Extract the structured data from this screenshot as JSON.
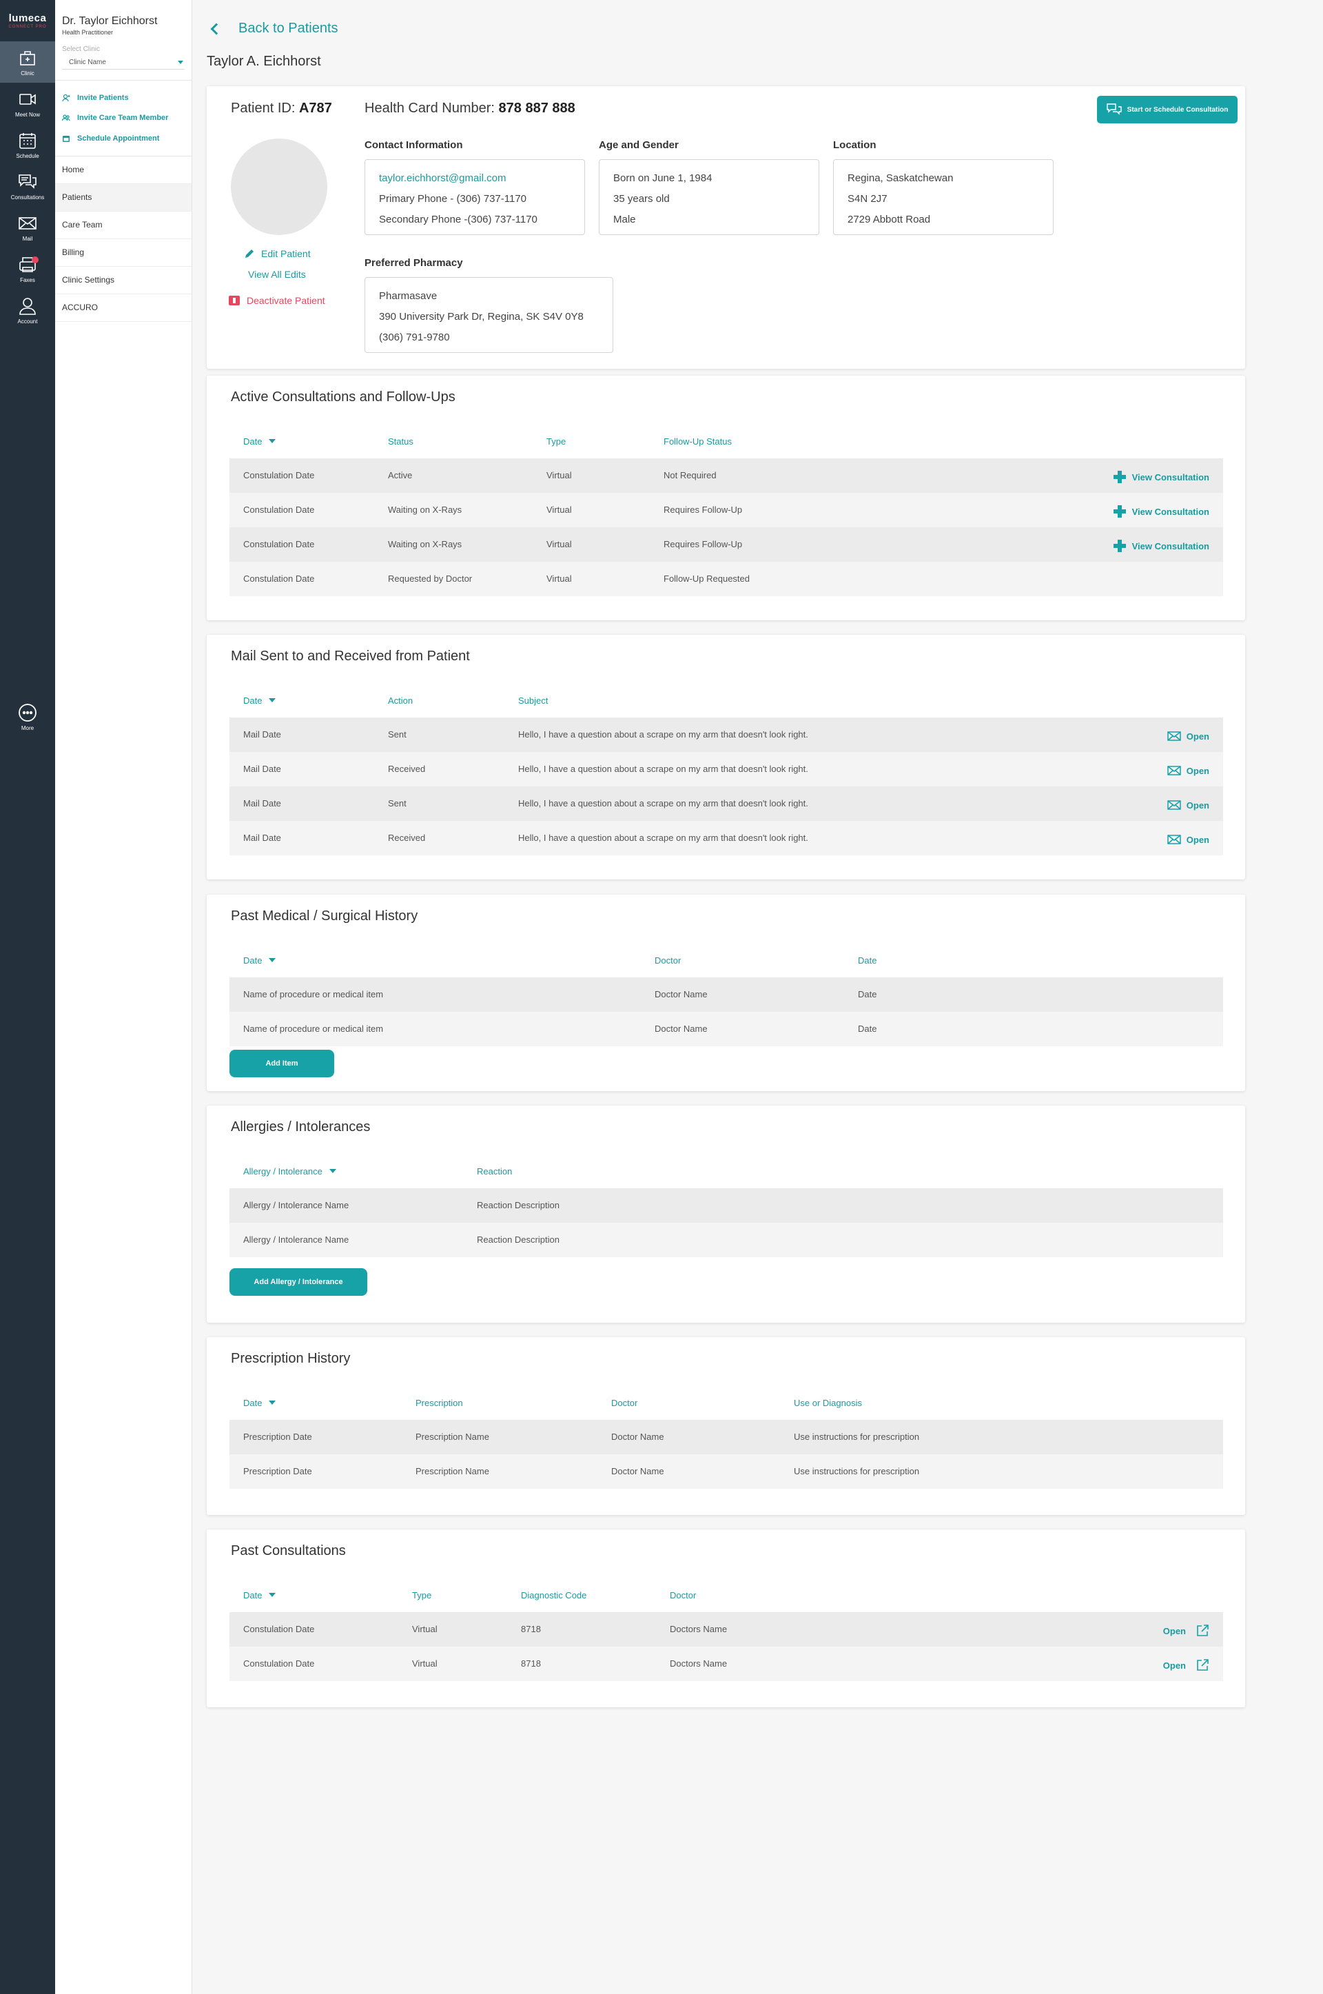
{
  "rail": {
    "brand": "lumeca",
    "brand_sub": "CONNECT PRO",
    "items": [
      {
        "label": "Clinic",
        "icon": "clinic-icon",
        "active": true
      },
      {
        "label": "Meet Now",
        "icon": "video-icon"
      },
      {
        "label": "Schedule",
        "icon": "calendar-icon"
      },
      {
        "label": "Consultations",
        "icon": "chat-icon"
      },
      {
        "label": "Mail",
        "icon": "mail-icon"
      },
      {
        "label": "Faxes",
        "icon": "fax-icon",
        "badge": true
      },
      {
        "label": "Account",
        "icon": "user-icon"
      }
    ],
    "more": "More"
  },
  "sidebar": {
    "doctor_name": "Dr. Taylor Eichhorst",
    "role": "Health Practitioner",
    "select_label": "Select Clinic",
    "clinic_value": "Clinic Name",
    "quick_actions": [
      "Invite Patients",
      "Invite Care Team Member",
      "Schedule Appointment"
    ],
    "nav": [
      "Home",
      "Patients",
      "Care Team",
      "Billing",
      "Clinic Settings",
      "ACCURO"
    ],
    "active_nav": "Patients"
  },
  "header": {
    "back_label": "Back to Patients",
    "patient_name": "Taylor A. Eichhorst"
  },
  "patient": {
    "id_label": "Patient ID:",
    "id_value": "A787",
    "hcn_label": "Health Card Number:",
    "hcn_value": "878 887 888",
    "start_button": "Start or Schedule Consultation",
    "edit_label": "Edit Patient",
    "view_edits_label": "View All Edits",
    "deactivate_label": "Deactivate Patient",
    "contact_title": "Contact Information",
    "email": "taylor.eichhorst@gmail.com",
    "primary_phone": "Primary Phone - (306) 737-1170",
    "secondary_phone": "Secondary Phone -(306) 737-1170",
    "age_title": "Age and Gender",
    "born": "Born on June 1, 1984",
    "age": "35 years old",
    "gender": "Male",
    "location_title": "Location",
    "city": "Regina, Saskatchewan",
    "postal": "S4N 2J7",
    "street": "2729 Abbott Road",
    "pharmacy_title": "Preferred Pharmacy",
    "pharmacy_name": "Pharmasave",
    "pharmacy_address": "390 University Park Dr, Regina, SK S4V 0Y8",
    "pharmacy_phone": "(306) 791-9780"
  },
  "consultations": {
    "title": "Active Consultations and Follow-Ups",
    "headers": [
      "Date",
      "Status",
      "Type",
      "Follow-Up Status"
    ],
    "action_label": "View Consultation",
    "rows": [
      {
        "date": "Constulation Date",
        "status": "Active",
        "type": "Virtual",
        "follow": "Not Required",
        "action": true
      },
      {
        "date": "Constulation Date",
        "status": "Waiting on X-Rays",
        "type": "Virtual",
        "follow": "Requires Follow-Up",
        "action": true
      },
      {
        "date": "Constulation Date",
        "status": "Waiting on X-Rays",
        "type": "Virtual",
        "follow": "Requires Follow-Up",
        "action": true
      },
      {
        "date": "Constulation Date",
        "status": "Requested by Doctor",
        "type": "Virtual",
        "follow": "Follow-Up Requested",
        "action": false
      }
    ]
  },
  "mail": {
    "title": "Mail Sent to and Received from Patient",
    "headers": [
      "Date",
      "Action",
      "Subject"
    ],
    "action_label": "Open",
    "rows": [
      {
        "date": "Mail Date",
        "action": "Sent",
        "subject": "Hello, I have a question about a scrape on my arm that doesn't look right."
      },
      {
        "date": "Mail Date",
        "action": "Received",
        "subject": "Hello, I have a question about a scrape on my arm that doesn't look right."
      },
      {
        "date": "Mail Date",
        "action": "Sent",
        "subject": "Hello, I have a question about a scrape on my arm that doesn't look right."
      },
      {
        "date": "Mail Date",
        "action": "Received",
        "subject": "Hello, I have a question about a scrape on my arm that doesn't look right."
      }
    ]
  },
  "history": {
    "title": "Past Medical / Surgical History",
    "headers": [
      "Date",
      "Doctor",
      "Date"
    ],
    "rows": [
      {
        "item": "Name of procedure or medical item",
        "doctor": "Doctor Name",
        "date": "Date"
      },
      {
        "item": "Name of procedure or medical item",
        "doctor": "Doctor Name",
        "date": "Date"
      }
    ],
    "add_button": "Add Item"
  },
  "allergies": {
    "title": "Allergies / Intolerances",
    "headers": [
      "Allergy / Intolerance",
      "Reaction"
    ],
    "rows": [
      {
        "name": "Allergy / Intolerance Name",
        "reaction": "Reaction Description"
      },
      {
        "name": "Allergy / Intolerance Name",
        "reaction": "Reaction Description"
      }
    ],
    "add_button": "Add Allergy / Intolerance"
  },
  "prescriptions": {
    "title": "Prescription History",
    "headers": [
      "Date",
      "Prescription",
      "Doctor",
      "Use or Diagnosis"
    ],
    "rows": [
      {
        "date": "Prescription Date",
        "name": "Prescription Name",
        "doctor": "Doctor Name",
        "use": "Use instructions for prescription"
      },
      {
        "date": "Prescription Date",
        "name": "Prescription Name",
        "doctor": "Doctor Name",
        "use": "Use instructions for prescription"
      }
    ]
  },
  "past": {
    "title": "Past Consultations",
    "headers": [
      "Date",
      "Type",
      "Diagnostic Code",
      "Doctor"
    ],
    "action_label": "Open",
    "rows": [
      {
        "date": "Constulation Date",
        "type": "Virtual",
        "code": "8718",
        "doctor": "Doctors Name"
      },
      {
        "date": "Constulation Date",
        "type": "Virtual",
        "code": "8718",
        "doctor": "Doctors Name"
      }
    ]
  },
  "colors": {
    "accent": "#17a2a8",
    "rail": "#24313d",
    "danger": "#e8455e"
  }
}
